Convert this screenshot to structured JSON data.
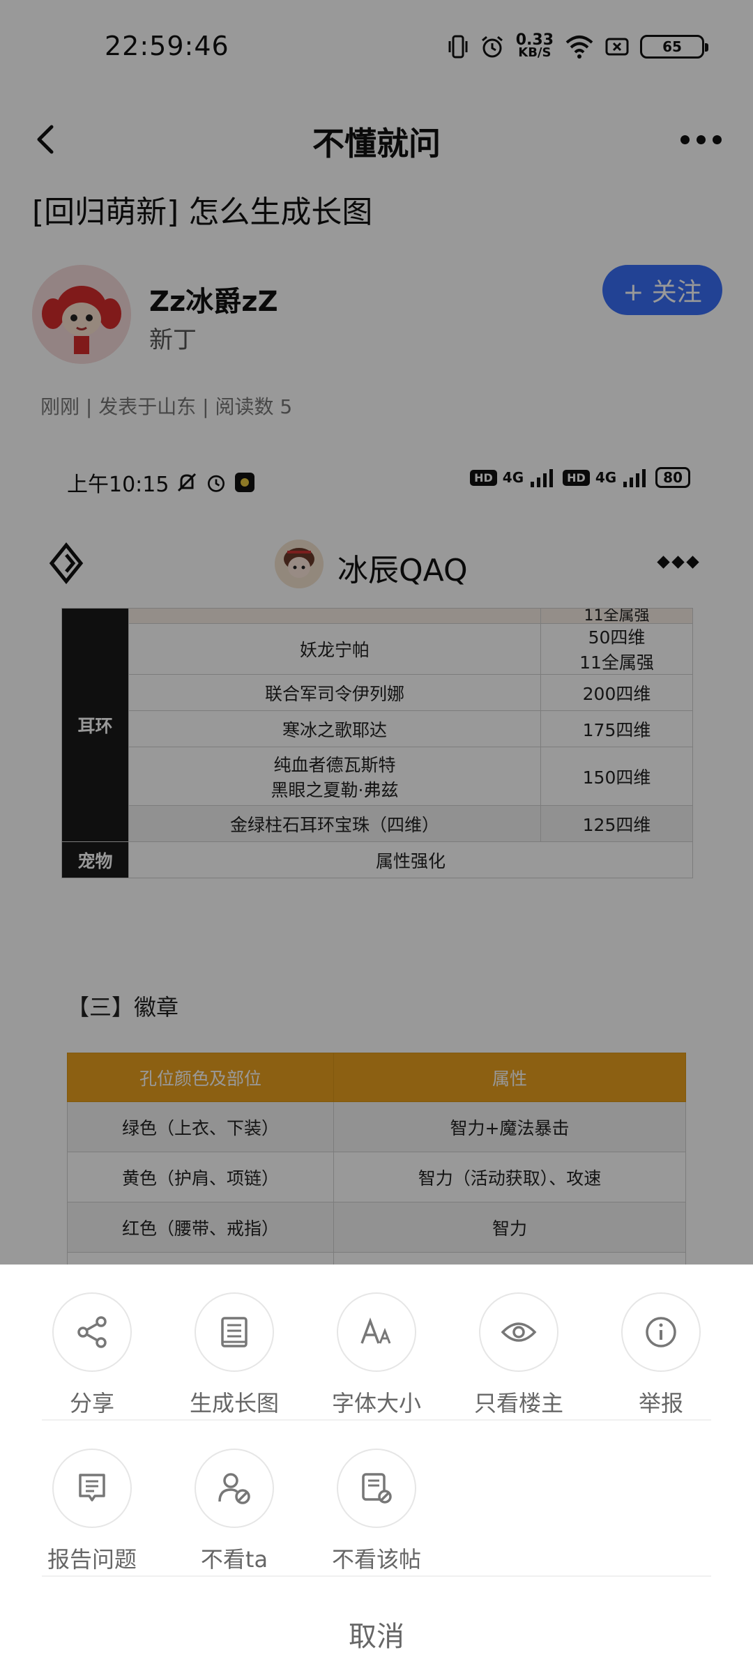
{
  "status_bar": {
    "time": "22:59:46",
    "net_speed_value": "0.33",
    "net_speed_unit": "KB/S",
    "battery": "65"
  },
  "nav": {
    "title": "不懂就问"
  },
  "post": {
    "title": "[回归萌新] 怎么生成长图",
    "author_name": "Zz冰爵zZ",
    "author_level": "新丁",
    "follow_label": "+ 关注",
    "meta": "刚刚 | 发表于山东 | 阅读数 5"
  },
  "embedded_screenshot": {
    "status_time": "上午10:15",
    "battery": "80",
    "signal_label": "4G",
    "hd_label": "HD",
    "header_name": "冰辰QAQ",
    "equipment_table": {
      "top_partial_value": "11全属强",
      "category_earring": "耳环",
      "category_pet": "宠物",
      "rows": [
        {
          "item": "妖龙宁帕",
          "value_1": "50四维",
          "value_2": "11全属强"
        },
        {
          "item": "联合军司令伊列娜",
          "value_1": "200四维"
        },
        {
          "item": "寒冰之歌耶达",
          "value_1": "175四维"
        },
        {
          "item": "纯血者德瓦斯特",
          "item_2": "黑眼之夏勒·弗兹",
          "value_1": "150四维"
        },
        {
          "item": "金绿柱石耳环宝珠（四维）",
          "value_1": "125四维"
        }
      ],
      "pet_value": "属性强化"
    },
    "section_title": "【三】徽章",
    "badge_table": {
      "headers": [
        "孔位颜色及部位",
        "属性"
      ],
      "rows": [
        [
          "绿色（上衣、下装）",
          "智力+魔法暴击"
        ],
        [
          "黄色（护肩、项链）",
          "智力（活动获取）、攻速"
        ],
        [
          "红色（腰带、戒指）",
          "智力"
        ]
      ]
    }
  },
  "share_sheet": {
    "row1": [
      {
        "label": "分享",
        "icon": "share-icon"
      },
      {
        "label": "生成长图",
        "icon": "long-image-icon"
      },
      {
        "label": "字体大小",
        "icon": "font-size-icon"
      },
      {
        "label": "只看楼主",
        "icon": "eye-icon"
      },
      {
        "label": "举报",
        "icon": "info-icon"
      }
    ],
    "row2": [
      {
        "label": "报告问题",
        "icon": "report-issue-icon"
      },
      {
        "label": "不看ta",
        "icon": "block-user-icon"
      },
      {
        "label": "不看该帖",
        "icon": "block-post-icon"
      }
    ],
    "cancel_label": "取消"
  }
}
